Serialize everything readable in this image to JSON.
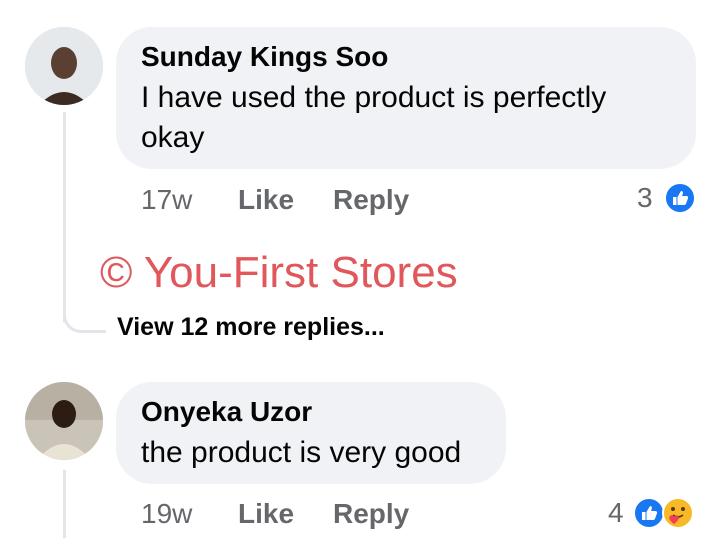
{
  "comments": [
    {
      "author": "Sunday Kings Soo",
      "text": "I have used the product is perfectly okay",
      "time": "17w",
      "like_label": "Like",
      "reply_label": "Reply",
      "reaction_count": "3",
      "reactions": [
        "like-icon"
      ]
    },
    {
      "author": "Onyeka Uzor",
      "text": "the product is very good",
      "time": "19w",
      "like_label": "Like",
      "reply_label": "Reply",
      "reaction_count": "4",
      "reactions": [
        "like-icon",
        "care-icon"
      ]
    }
  ],
  "view_more": "View 12 more replies...",
  "watermark": "© You-First Stores",
  "colors": {
    "bubble": "#f0f2f5",
    "meta_text": "#65676b",
    "like_blue": "#1877f2",
    "watermark": "#e0575c",
    "care_yellow": "#f7b928"
  }
}
